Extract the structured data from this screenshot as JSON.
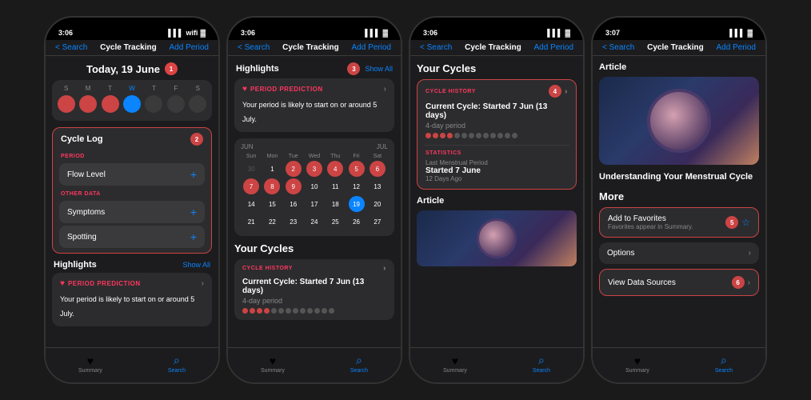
{
  "phones": [
    {
      "id": "phone1",
      "status_time": "3:06",
      "nav_back": "< Search",
      "nav_title": "Cycle Tracking",
      "nav_action": "Add Period",
      "date_header": "Today, 19 June",
      "badge1": "1",
      "cal_days_labels": [
        "S",
        "M",
        "T",
        "W",
        "T",
        "F",
        "S"
      ],
      "cycle_log_title": "Cycle Log",
      "badge2": "2",
      "period_label": "PERIOD",
      "flow_level": "Flow Level",
      "other_data_label": "OTHER DATA",
      "symptoms": "Symptoms",
      "spotting": "Spotting",
      "highlights_title": "Highlights",
      "show_all": "Show All",
      "period_prediction": "PERIOD PREDICTION",
      "prediction_text": "Your period is likely to start on or around 5 July.",
      "tab1": "Summary",
      "tab2": "Search"
    },
    {
      "id": "phone2",
      "status_time": "3:06",
      "nav_back": "< Search",
      "nav_title": "Cycle Tracking",
      "nav_action": "Add Period",
      "highlights_title": "Highlights",
      "badge3": "3",
      "show_all": "Show All",
      "period_prediction": "PERIOD PREDICTION",
      "prediction_text": "Your period is likely to start on or around 5 July.",
      "cal_months": [
        "JUN",
        "JUL"
      ],
      "cal_days_labels": [
        "Sun",
        "Mon",
        "Tue",
        "Wed",
        "Thu",
        "Fri",
        "Sat"
      ],
      "your_cycles": "Your Cycles",
      "cycle_history": "CYCLE HISTORY",
      "current_cycle": "Current Cycle: Started 7 Jun (13 days)",
      "four_day": "4-day period",
      "tab1": "Summary",
      "tab2": "Search"
    },
    {
      "id": "phone3",
      "status_time": "3:06",
      "nav_back": "< Search",
      "nav_title": "Cycle Tracking",
      "nav_action": "Add Period",
      "your_cycles": "Your Cycles",
      "cycle_history": "CYCLE HISTORY",
      "badge4": "4",
      "current_cycle": "Current Cycle: Started 7 Jun (13 days)",
      "four_day": "4-day period",
      "statistics": "STATISTICS",
      "last_period": "Last Menstrual Period",
      "started": "Started 7 June",
      "days_ago": "12 Days Ago",
      "article_label": "Article",
      "tab1": "Summary",
      "tab2": "Search"
    },
    {
      "id": "phone4",
      "status_time": "3:07",
      "nav_back": "< Search",
      "nav_title": "Cycle Tracking",
      "nav_action": "Add Period",
      "article_label": "Article",
      "article_title": "Understanding Your Menstrual Cycle",
      "more_label": "More",
      "add_favorites": "Add to Favorites",
      "favorites_sub": "Favorites appear in Summary.",
      "badge5": "5",
      "options": "Options",
      "view_data": "View Data Sources",
      "badge6": "6",
      "tab1": "Summary",
      "tab2": "Search"
    }
  ]
}
